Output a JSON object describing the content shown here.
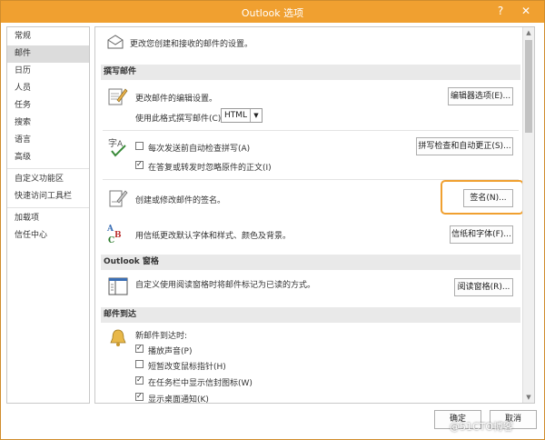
{
  "window": {
    "title": "Outlook 选项",
    "help": "?",
    "close": "✕"
  },
  "nav": {
    "items": [
      "常规",
      "邮件",
      "日历",
      "人员",
      "任务",
      "搜索",
      "语言",
      "高级",
      "自定义功能区",
      "快速访问工具栏",
      "加载项",
      "信任中心"
    ],
    "selected": "邮件"
  },
  "header": {
    "text": "更改您创建和接收的邮件的设置。"
  },
  "compose": {
    "heading": "撰写邮件",
    "edit_text": "更改邮件的编辑设置。",
    "editor_button": "编辑器选项(E)...",
    "format_label": "使用此格式撰写邮件(C):",
    "format_value": "HTML",
    "spell_check_label": "每次发送前自动检查拼写(A)",
    "spell_check_checked": false,
    "ignore_original_label": "在答复或转发时忽略原件的正文(I)",
    "ignore_original_checked": true,
    "spelling_button": "拼写检查和自动更正(S)...",
    "signature_text": "创建或修改邮件的签名。",
    "signature_button": "签名(N)...",
    "stationery_text": "用信纸更改默认字体和样式、颜色及背景。",
    "stationery_button": "信纸和字体(F)..."
  },
  "reading_pane": {
    "heading": "Outlook 窗格",
    "text": "自定义使用阅读窗格时将邮件标记为已读的方式。",
    "button": "阅读窗格(R)..."
  },
  "arrival": {
    "heading": "邮件到达",
    "when_arrive": "新邮件到达时:",
    "options": [
      {
        "label": "播放声音(P)",
        "checked": true
      },
      {
        "label": "短暂改变鼠标指针(H)",
        "checked": false
      },
      {
        "label": "在任务栏中显示信封图标(W)",
        "checked": true
      },
      {
        "label": "显示桌面通知(K)",
        "checked": true
      }
    ]
  },
  "footer": {
    "ok": "确定",
    "cancel": "取消"
  },
  "watermark": "@51CTO博客",
  "colors": {
    "titlebar": "#f0a030",
    "highlight": "#f0a030"
  }
}
